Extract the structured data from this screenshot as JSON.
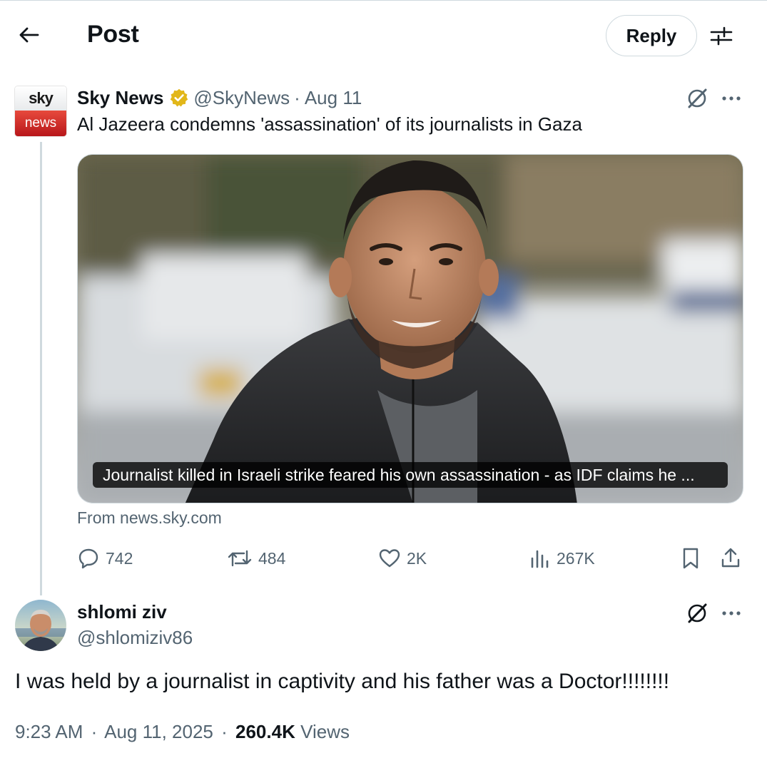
{
  "header": {
    "title": "Post",
    "reply_label": "Reply",
    "back_icon": "arrow-left-icon",
    "settings_icon": "sliders-icon"
  },
  "parent_tweet": {
    "avatar_logo": {
      "top": "sky",
      "bottom": "news"
    },
    "author_name": "Sky News",
    "handle": "@SkyNews",
    "separator": "·",
    "date": "Aug 11",
    "text": "Al Jazeera condemns 'assassination' of its journalists in Gaza",
    "card": {
      "caption": "Journalist killed in Israeli strike feared his own assassination - as IDF claims he ...",
      "source": "From news.sky.com"
    },
    "actions": {
      "replies": "742",
      "reposts": "484",
      "likes": "2K",
      "views": "267K"
    }
  },
  "reply_tweet": {
    "author_name": "shlomi ziv",
    "handle": "@shlomiziv86",
    "text": "I was held by a journalist in captivity and his father was a Doctor!!!!!!!!",
    "time": "9:23 AM",
    "separator": "·",
    "date": "Aug 11, 2025",
    "views_count": "260.4K",
    "views_label": "Views"
  },
  "colors": {
    "text_primary": "#0f1419",
    "text_secondary": "#536471",
    "border": "#cfd9de",
    "verified_gold": "#e2b719",
    "sky_red": "#c8202a"
  }
}
